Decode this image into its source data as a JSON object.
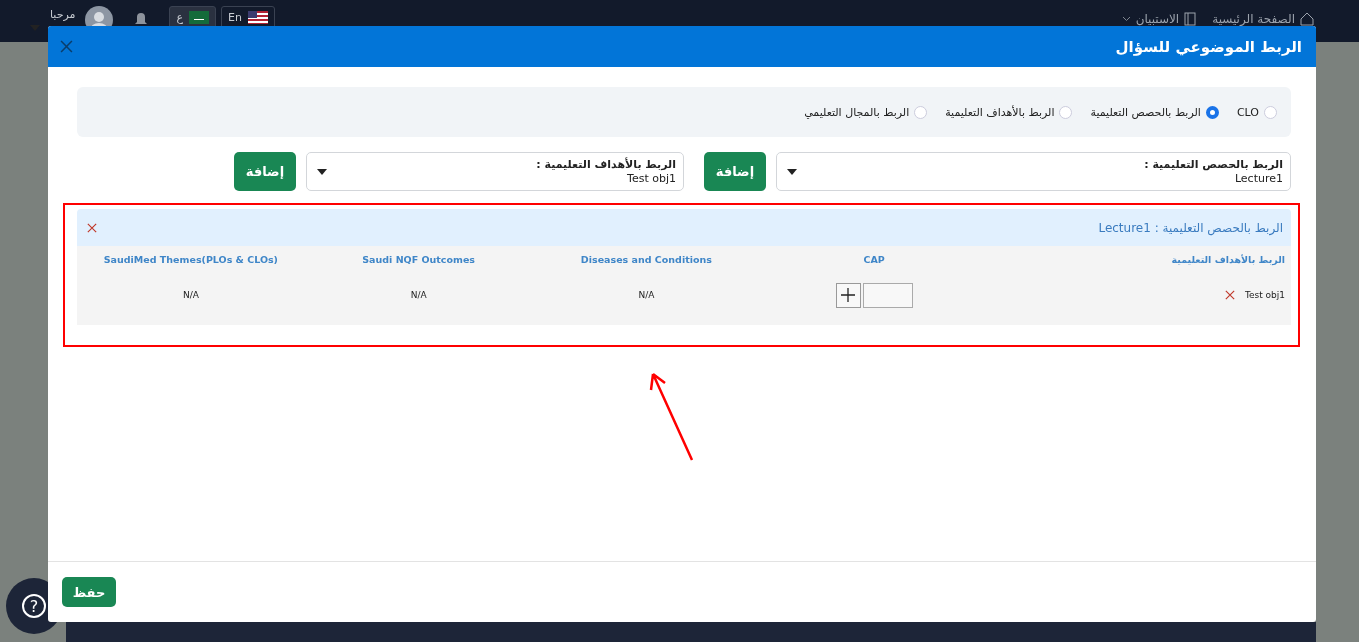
{
  "topbar": {
    "greeting": "مرحبا",
    "languages": [
      {
        "label": "En",
        "selected": false
      },
      {
        "label": "ع",
        "selected": true
      }
    ],
    "nav": [
      {
        "label": "الصفحة الرئيسية",
        "kind": "home"
      },
      {
        "label": "الاستبيان",
        "kind": "menu"
      }
    ]
  },
  "help": {
    "label": "?"
  },
  "modal": {
    "title": "الربط الموضوعي للسؤال",
    "link_types": [
      {
        "label": "CLO",
        "selected": false
      },
      {
        "label": "الربط بالحصص التعليمية",
        "selected": true
      },
      {
        "label": "الربط بالأهداف التعليمية",
        "selected": false
      },
      {
        "label": "الربط بالمجال التعليمي",
        "selected": false
      }
    ],
    "selectors": [
      {
        "label": "الربط بالحصص التعليمية :",
        "value": "Lecture1",
        "button": "إضافة"
      },
      {
        "label": "الربط بالأهداف التعليمية :",
        "value": "Test obj1",
        "button": "إضافة"
      }
    ],
    "panel": {
      "title": "الربط بالحصص التعليمية : Lecture1",
      "columns": [
        "الربط بالأهداف التعليمية",
        "CAP",
        "Diseases and Conditions",
        "Saudi NQF Outcomes",
        "SaudiMed Themes(PLOs & CLOs)"
      ],
      "rows": [
        {
          "cells": [
            {
              "kind": "objective",
              "text": "Test obj1"
            },
            {
              "kind": "cap"
            },
            {
              "kind": "text",
              "text": "N/A"
            },
            {
              "kind": "text",
              "text": "N/A"
            },
            {
              "kind": "text",
              "text": "N/A"
            }
          ]
        }
      ]
    },
    "save": "حفظ"
  }
}
